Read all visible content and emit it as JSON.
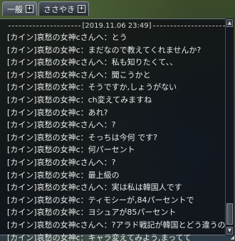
{
  "tabs": [
    {
      "label": "一般",
      "plus": "+",
      "active": true
    },
    {
      "label": "ささやき",
      "plus": "+",
      "active": false
    }
  ],
  "log": {
    "date": "[2019.11.06 23:49]",
    "lines": [
      "[カイン]哀愁の女神cさんへ：とう",
      "[カイン]哀愁の女神c：まだなので教えてくれませんか?",
      "[カイン]哀愁の女神cさんへ：私も知りたくて、、",
      "[カイン]哀愁の女神cさんへ：聞こうかと",
      "[カイン]哀愁の女神c：そうですか,しょうがない",
      "[カイン]哀愁の女神c：ch変えてみますね",
      "[カイン]哀愁の女神c：あれ?",
      "[カイン]哀愁の女神cさんへ：?",
      "[カイン]哀愁の女神c：そっちは今何 です?",
      "[カイン]哀愁の女神c：何パーセント",
      "[カイン]哀愁の女神cさんへ：?",
      "[カイン]哀愁の女神c：最上級の",
      "[カイン]哀愁の女神cさんへ：実は私は韓国人です",
      "[カイン]哀愁の女神c：ティモシーが,84パーセントで",
      "[カイン]哀愁の女神c：ヨシュアが85パーセント",
      "[カイン]哀愁の女神cさんへ：?アラド戦記が韓国とどう違うのか",
      "[カイン]哀愁の女神c：キャラ変えてみよう,まってて"
    ]
  },
  "scrollbar": {
    "up_glyph": "▲",
    "down_glyph": "▼",
    "grip_glyph": "◢"
  }
}
